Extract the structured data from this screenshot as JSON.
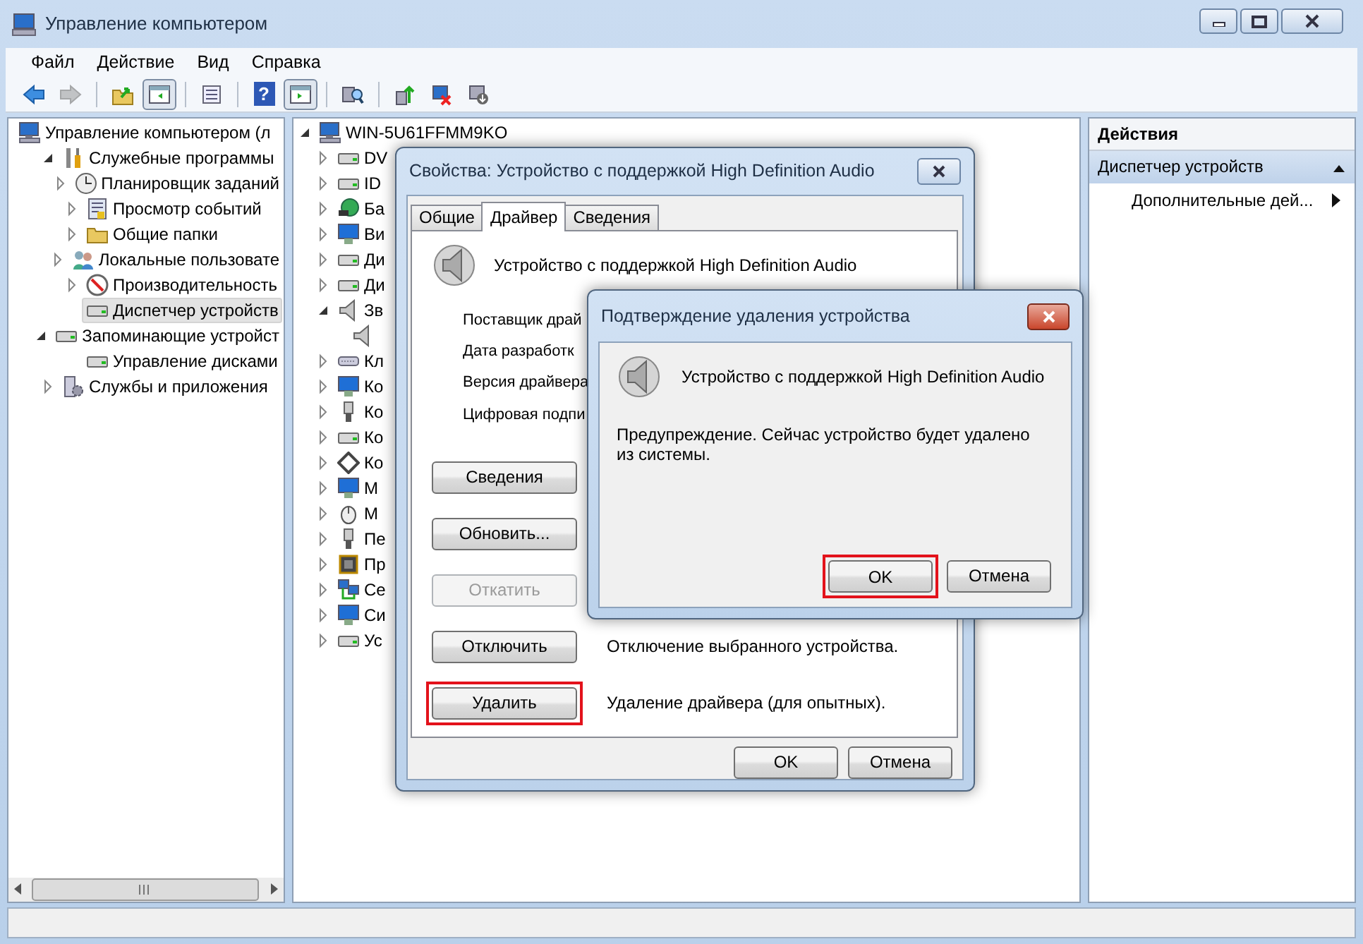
{
  "window": {
    "title": "Управление компьютером"
  },
  "menu": [
    "Файл",
    "Действие",
    "Вид",
    "Справка"
  ],
  "toolbar": {
    "groups": [
      [
        {
          "pressed": false,
          "disabled": false
        },
        {
          "pressed": false,
          "disabled": true
        }
      ],
      [
        {
          "pressed": false,
          "disabled": false
        },
        {
          "pressed": true,
          "disabled": false
        }
      ],
      [
        {
          "pressed": false,
          "disabled": false
        }
      ],
      [
        {
          "label": "?",
          "pressed": false,
          "disabled": false
        },
        {
          "pressed": true,
          "disabled": false
        }
      ],
      [
        {
          "pressed": false,
          "disabled": false
        }
      ],
      [
        {
          "pressed": false,
          "disabled": false
        },
        {
          "pressed": false,
          "disabled": false
        },
        {
          "pressed": false,
          "disabled": false
        }
      ]
    ]
  },
  "console_tree": {
    "items": [
      {
        "label": "Управление компьютером (л",
        "selected": false,
        "children": [
          {
            "label": "Служебные программы",
            "expanded": true,
            "selected": false,
            "children": [
              {
                "label": "Планировщик заданий",
                "expanded": false,
                "selected": false
              },
              {
                "label": "Просмотр событий",
                "expanded": false,
                "selected": false
              },
              {
                "label": "Общие папки",
                "expanded": false,
                "selected": false
              },
              {
                "label": "Локальные пользовате",
                "expanded": false,
                "selected": false
              },
              {
                "label": "Производительность",
                "expanded": false,
                "selected": false
              },
              {
                "label": "Диспетчер устройств",
                "selected": true
              }
            ]
          },
          {
            "label": "Запоминающие устройст",
            "expanded": true,
            "selected": false,
            "children": [
              {
                "label": "Управление дисками",
                "selected": false
              }
            ]
          },
          {
            "label": "Службы и приложения",
            "expanded": false,
            "selected": false
          }
        ]
      }
    ]
  },
  "device_tree": {
    "items": [
      {
        "label": "WIN-5U61FFMM9KO",
        "expanded": true,
        "children": [
          {
            "label": "DV",
            "expanded": false
          },
          {
            "label": "ID",
            "expanded": false
          },
          {
            "label": "Ба",
            "expanded": false
          },
          {
            "label": "Ви",
            "expanded": false
          },
          {
            "label": "Ди",
            "expanded": false
          },
          {
            "label": "Ди",
            "expanded": false
          },
          {
            "label": "Зв",
            "expanded": true
          },
          {
            "label": "Кл",
            "expanded": false
          },
          {
            "label": "Ко",
            "expanded": false
          },
          {
            "label": "Ко",
            "expanded": false
          },
          {
            "label": "Ко",
            "expanded": false
          },
          {
            "label": "Ко",
            "expanded": false
          },
          {
            "label": "М",
            "expanded": false
          },
          {
            "label": "М",
            "expanded": false
          },
          {
            "label": "Пе",
            "expanded": false
          },
          {
            "label": "Пр",
            "expanded": false
          },
          {
            "label": "Се",
            "expanded": false
          },
          {
            "label": "Си",
            "expanded": false
          },
          {
            "label": "Ус",
            "expanded": false
          }
        ]
      }
    ]
  },
  "actions_pane": {
    "title": "Действия",
    "section": {
      "label": "Диспетчер устройств",
      "expanded": true
    },
    "items": [
      "Дополнительные дей..."
    ]
  },
  "properties_dialog": {
    "title": "Свойства: Устройство с поддержкой High Definition Audio",
    "tabs": [
      {
        "label": "Общие",
        "selected": false
      },
      {
        "label": "Драйвер",
        "selected": true
      },
      {
        "label": "Сведения",
        "selected": false
      }
    ],
    "device_name": "Устройство с поддержкой High Definition Audio",
    "fields": [
      "Поставщик драй",
      "Дата разработк",
      "Версия драйвера",
      "Цифровая подпи"
    ],
    "actions": [
      {
        "label": "Сведения",
        "disabled": false,
        "highlighted": false
      },
      {
        "label": "Обновить...",
        "disabled": false,
        "highlighted": false
      },
      {
        "label": "Откатить",
        "disabled": true,
        "highlighted": false
      },
      {
        "label": "Отключить",
        "disabled": false,
        "highlighted": false,
        "description": "Отключение выбранного устройства."
      },
      {
        "label": "Удалить",
        "disabled": false,
        "highlighted": true,
        "description": "Удаление драйвера (для опытных)."
      }
    ],
    "buttons": [
      "OK",
      "Отмена"
    ]
  },
  "confirm_dialog": {
    "title": "Подтверждение удаления устройства",
    "device_name": "Устройство с поддержкой High Definition Audio",
    "message": "Предупреждение. Сейчас устройство будет удалено из системы.",
    "buttons": [
      {
        "label": "OK",
        "highlighted": true
      },
      {
        "label": "Отмена",
        "highlighted": false
      }
    ]
  }
}
